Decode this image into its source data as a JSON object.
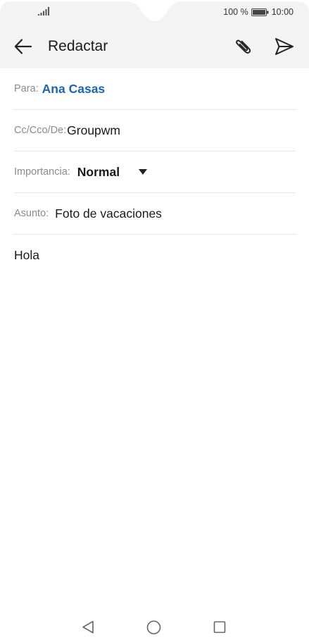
{
  "status_bar": {
    "battery_percent": "100 %",
    "time": "10:00",
    "battery_level": 1.0
  },
  "app_bar": {
    "title": "Redactar",
    "icons": {
      "back": "arrow-left-icon",
      "attach": "paperclip-icon",
      "send": "send-icon"
    }
  },
  "form": {
    "to": {
      "label": "Para:",
      "value": "Ana Casas"
    },
    "cc": {
      "label": "Cc/Cco/De:",
      "value": "Groupwm"
    },
    "importance": {
      "label": "Importancia:",
      "value": "Normal"
    },
    "subject": {
      "label": "Asunto:",
      "value": "Foto de vacaciones"
    }
  },
  "body": {
    "text": "Hola"
  },
  "colors": {
    "accent": "#1a66b0",
    "top_bar": "#f3f3f3",
    "divider": "#e6e6e6",
    "label": "#8a8a8a"
  },
  "nav_bar": {
    "icons": [
      "triangle-back-icon",
      "circle-home-icon",
      "square-recent-icon"
    ]
  }
}
